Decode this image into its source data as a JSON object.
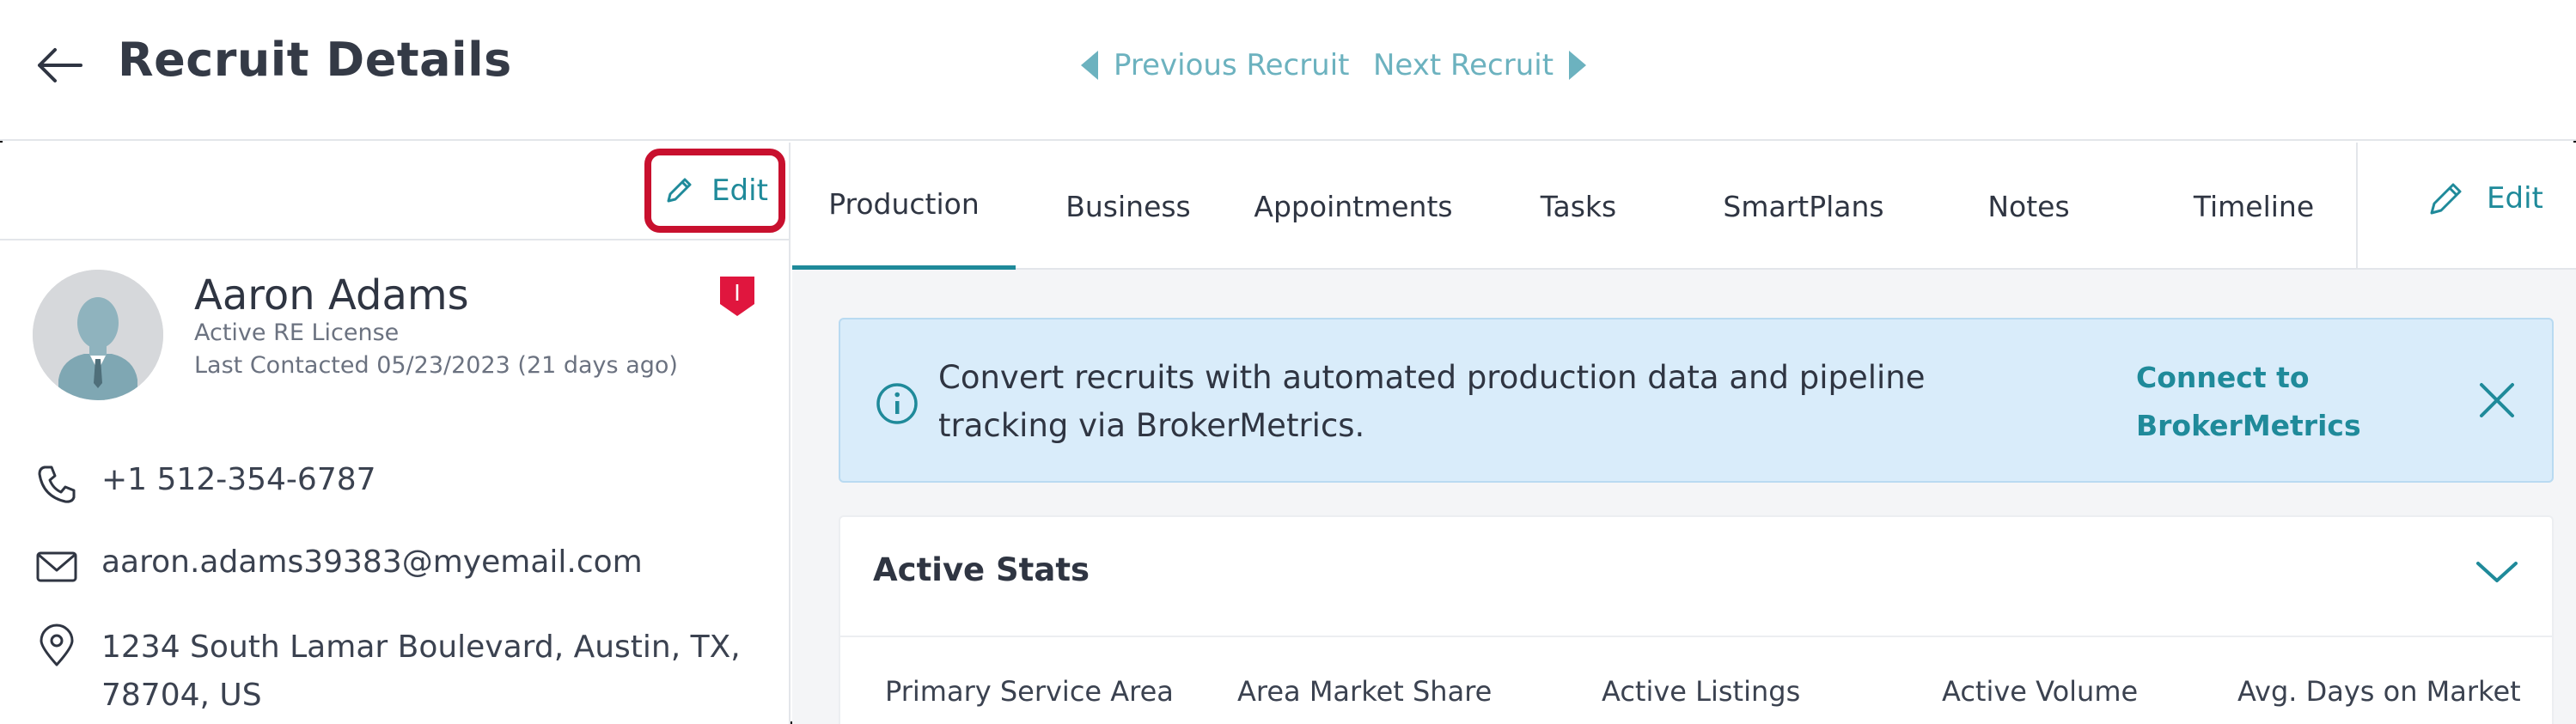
{
  "header": {
    "title": "Recruit Details",
    "prev_label": "Previous Recruit",
    "next_label": "Next Recruit"
  },
  "left_panel": {
    "edit_label": "Edit",
    "name": "Aaron Adams",
    "license": "Active RE License",
    "last_contacted": "Last Contacted 05/23/2023 (21 days ago)",
    "badge_letter": "I",
    "phone": "+1 512-354-6787",
    "email": "aaron.adams39383@myemail.com",
    "address_line1": "1234 South Lamar Boulevard, Austin, TX,",
    "address_line2": "78704, US"
  },
  "tabs": [
    {
      "label": "Production",
      "active": true
    },
    {
      "label": "Business",
      "active": false
    },
    {
      "label": "Appointments",
      "active": false
    },
    {
      "label": "Tasks",
      "active": false
    },
    {
      "label": "SmartPlans",
      "active": false
    },
    {
      "label": "Notes",
      "active": false
    },
    {
      "label": "Timeline",
      "active": false
    }
  ],
  "right_panel": {
    "edit_label": "Edit"
  },
  "banner": {
    "text": "Convert recruits with automated production data and pipeline tracking via BrokerMetrics.",
    "link_label": "Connect to BrokerMetrics"
  },
  "stats": {
    "title": "Active Stats",
    "columns": [
      "Primary Service Area",
      "Area Market Share",
      "Active Listings",
      "Active Volume",
      "Avg. Days on Market"
    ]
  },
  "colors": {
    "accent": "#1f8a9a",
    "nav_link": "#6cb2bf",
    "highlight_box": "#c8102e",
    "banner_bg": "#d9ecfa",
    "badge": "#e0163e"
  },
  "icons": {
    "back": "arrow-left-icon",
    "prev": "triangle-left-icon",
    "next": "triangle-right-icon",
    "edit": "pencil-icon",
    "phone": "phone-icon",
    "email": "envelope-icon",
    "address": "map-pin-icon",
    "info": "info-circle-icon",
    "close": "close-icon",
    "collapse": "chevron-down-icon",
    "badge": "shield-badge-icon"
  }
}
